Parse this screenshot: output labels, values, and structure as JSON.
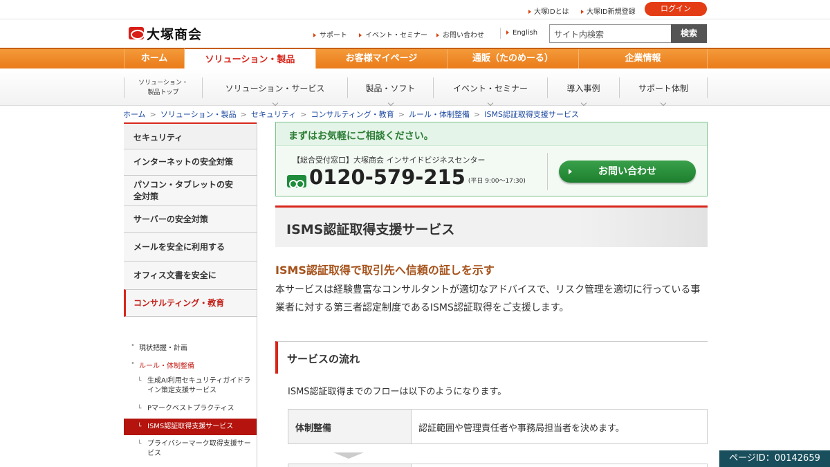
{
  "util": {
    "id_about": "大塚IDとは",
    "id_register": "大塚ID新規登録",
    "login": "ログイン"
  },
  "header": {
    "logo": "大塚商会",
    "links": [
      "サポート",
      "イベント・セミナー",
      "お問い合わせ"
    ],
    "english": "English",
    "search_placeholder": "サイト内検索",
    "search_button": "検索"
  },
  "gnav": [
    {
      "label": "ホーム"
    },
    {
      "label": "ソリューション・製品"
    },
    {
      "label": "お客様マイページ"
    },
    {
      "label": "通販（たのめーる）"
    },
    {
      "label": "企業情報"
    }
  ],
  "snav": {
    "top_line1": "ソリューション・",
    "top_line2": "製品トップ",
    "items": [
      "ソリューション・サービス",
      "製品・ソフト",
      "イベント・セミナー",
      "導入事例",
      "サポート体制"
    ]
  },
  "breadcrumb": [
    "ホーム",
    "ソリューション・製品",
    "セキュリティ",
    "コンサルティング・教育",
    "ルール・体制整備",
    "ISMS認証取得支援サービス"
  ],
  "side": {
    "header": "セキュリティ",
    "items": [
      "インターネットの安全対策",
      "パソコン・タブレットの安全対策",
      "サーバーの安全対策",
      "メールを安全に利用する",
      "オフィス文書を安全に",
      "コンサルティング・教育"
    ],
    "subs": [
      "現状把握・計画",
      "ルール・体制整備"
    ],
    "subsubs": [
      "生成AI利用セキュリティガイドライン策定支援サービス",
      "Pマークベストプラクティス",
      "ISMS認証取得支援サービス",
      "プライバシーマーク取得支援サービス"
    ]
  },
  "contact": {
    "title": "まずはお気軽にご相談ください。",
    "desk": "【総合受付窓口】大塚商会 インサイドビジネスセンター",
    "tel": "0120-579-215",
    "hours": "(平日 9:00～17:30)",
    "button": "お問い合わせ"
  },
  "main": {
    "title": "ISMS認証取得支援サービス",
    "lead": "ISMS認証取得で取引先へ信頼の証しを示す",
    "body": "本サービスは経験豊富なコンサルタントが適切なアドバイスで、リスク管理を適切に行っている事業者に対する第三者認定制度であるISMS認証取得をご支援します。",
    "h2": "サービスの流れ",
    "flow": "ISMS認証取得までのフローは以下のようになります。",
    "table": {
      "th": "体制整備",
      "td": "認証範囲や管理責任者や事務局担当者を決めます。"
    }
  },
  "page_id": "ページID：00142659",
  "colors": {
    "accent": "#d8261b",
    "orange": "#ea7b1a",
    "green": "#1c7f2e"
  }
}
